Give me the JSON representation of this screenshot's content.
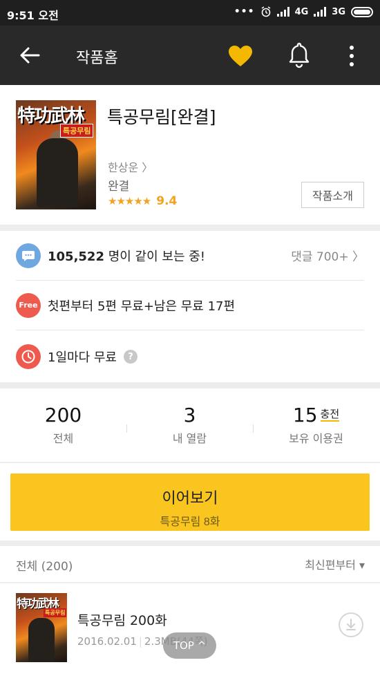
{
  "status_bar": {
    "time": "9:51 오전",
    "signal1": "4G",
    "signal2": "3G"
  },
  "app_bar": {
    "title": "작품홈"
  },
  "work": {
    "cover_text": "特功武林",
    "cover_badge": "특공무림",
    "title": "특공무림[완결]",
    "author": "한상운 〉",
    "status": "완결",
    "stars": "★★★★★",
    "score": "9.4",
    "intro_button": "작품소개"
  },
  "info": {
    "viewers_count": "105,522",
    "viewers_text": " 명이 같이 보는 중!",
    "comments": "댓글 700+ 〉",
    "free_badge": "Free",
    "free_text": "첫편부터 5편 무료+남은 무료 17편",
    "timer_text": "1일마다 무료",
    "help_icon": "?"
  },
  "stats": {
    "total_value": "200",
    "total_label": "전체",
    "read_value": "3",
    "read_label": "내 열람",
    "ticket_value": "15",
    "ticket_charge": "충전",
    "ticket_label": "보유 이용권"
  },
  "continue": {
    "label": "이어보기",
    "episode": "특공무림 8화"
  },
  "list": {
    "total": "전체 (200)",
    "sort": "최신편부터 ▾",
    "episodes": [
      {
        "title": "특공무림 200화",
        "date": "2016.02.01",
        "size": "2.3MB(44쪽)"
      }
    ]
  },
  "top_button": "TOP ^",
  "colors": {
    "accent": "#f9c51e",
    "heart": "#f5b800",
    "rating": "#f4a21f",
    "free": "#ef5a4e",
    "chat": "#6fa8e0"
  }
}
